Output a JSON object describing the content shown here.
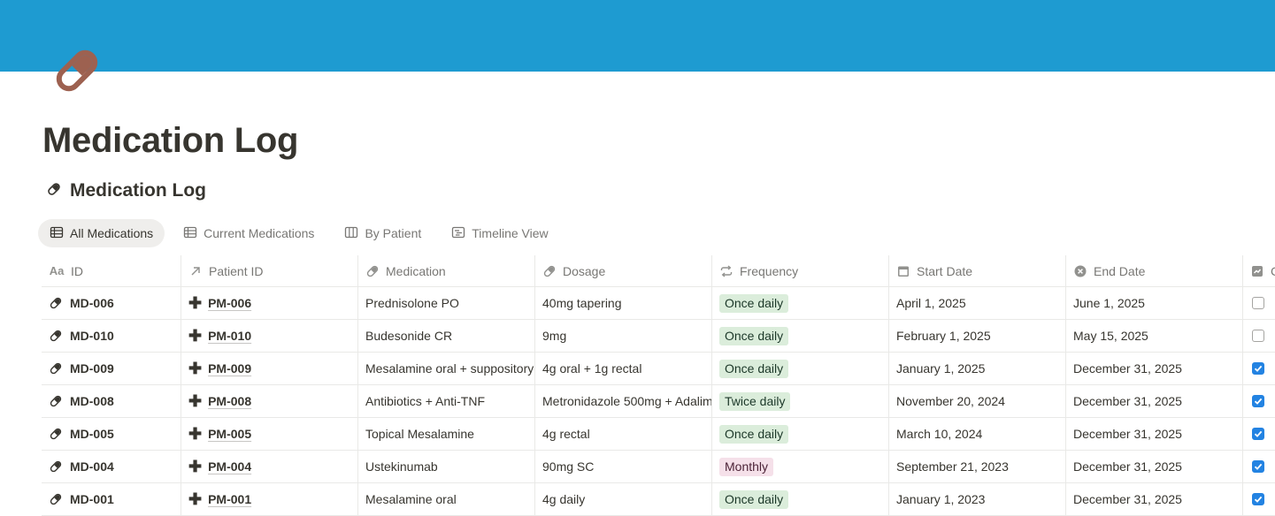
{
  "page": {
    "title": "Medication Log",
    "cover_color": "#1e9bd1",
    "icon": "pill-icon"
  },
  "database": {
    "title": "Medication Log",
    "icon": "pill-icon"
  },
  "tabs": [
    {
      "label": "All Medications",
      "icon": "table-icon",
      "active": true
    },
    {
      "label": "Current Medications",
      "icon": "table-icon",
      "active": false
    },
    {
      "label": "By Patient",
      "icon": "board-icon",
      "active": false
    },
    {
      "label": "Timeline View",
      "icon": "timeline-icon",
      "active": false
    }
  ],
  "columns": [
    {
      "label": "ID",
      "icon": "title-icon"
    },
    {
      "label": "Patient ID",
      "icon": "relation-arrow-icon"
    },
    {
      "label": "Medication",
      "icon": "pill-icon"
    },
    {
      "label": "Dosage",
      "icon": "pill-icon"
    },
    {
      "label": "Frequency",
      "icon": "repeat-icon"
    },
    {
      "label": "Start Date",
      "icon": "calendar-icon"
    },
    {
      "label": "End Date",
      "icon": "x-circle-icon"
    },
    {
      "label": "C",
      "icon": "checkbox-column-icon"
    }
  ],
  "rows": [
    {
      "id": "MD-006",
      "patient": "PM-006",
      "medication": "Prednisolone PO",
      "dosage": "40mg tapering",
      "frequency": "Once daily",
      "freq_color": "green",
      "start": "April 1, 2025",
      "end": "June 1, 2025",
      "checked": false
    },
    {
      "id": "MD-010",
      "patient": "PM-010",
      "medication": "Budesonide CR",
      "dosage": "9mg",
      "frequency": "Once daily",
      "freq_color": "green",
      "start": "February 1, 2025",
      "end": "May 15, 2025",
      "checked": false
    },
    {
      "id": "MD-009",
      "patient": "PM-009",
      "medication": "Mesalamine oral + suppository",
      "dosage": "4g oral + 1g rectal",
      "frequency": "Once daily",
      "freq_color": "green",
      "start": "January 1, 2025",
      "end": "December 31, 2025",
      "checked": true
    },
    {
      "id": "MD-008",
      "patient": "PM-008",
      "medication": "Antibiotics + Anti-TNF",
      "dosage": "Metronidazole 500mg + Adalim",
      "frequency": "Twice daily",
      "freq_color": "green",
      "start": "November 20, 2024",
      "end": "December 31, 2025",
      "checked": true
    },
    {
      "id": "MD-005",
      "patient": "PM-005",
      "medication": "Topical Mesalamine",
      "dosage": "4g rectal",
      "frequency": "Once daily",
      "freq_color": "green",
      "start": "March 10, 2024",
      "end": "December 31, 2025",
      "checked": true
    },
    {
      "id": "MD-004",
      "patient": "PM-004",
      "medication": "Ustekinumab",
      "dosage": "90mg SC",
      "frequency": "Monthly",
      "freq_color": "pink",
      "start": "September 21, 2023",
      "end": "December 31, 2025",
      "checked": true
    },
    {
      "id": "MD-001",
      "patient": "PM-001",
      "medication": "Mesalamine oral",
      "dosage": "4g daily",
      "frequency": "Once daily",
      "freq_color": "green",
      "start": "January 1, 2023",
      "end": "December 31, 2025",
      "checked": true
    }
  ]
}
